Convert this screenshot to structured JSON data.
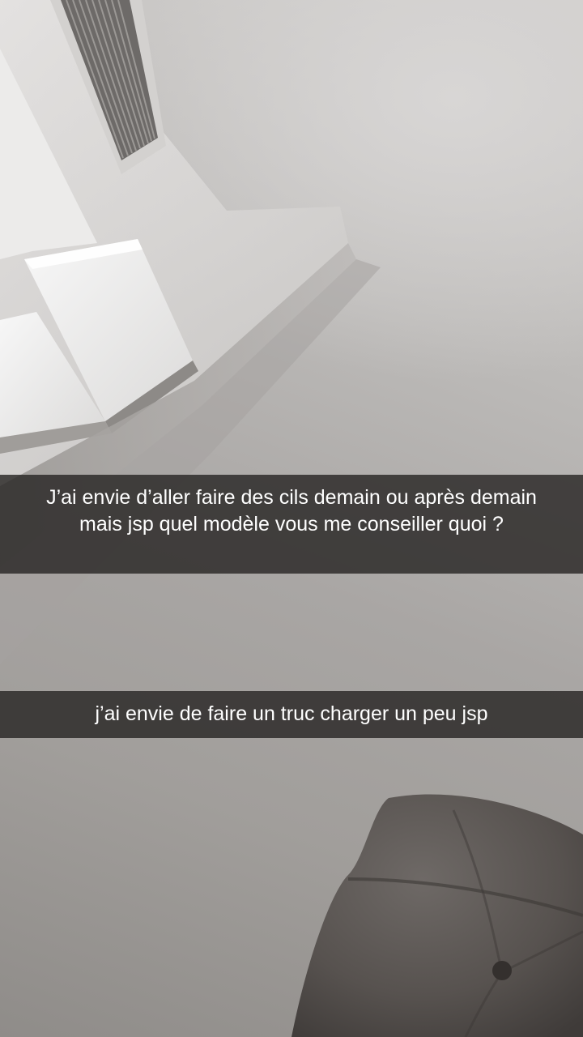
{
  "captions": [
    {
      "text": "J’ai envie d’aller faire des cils demain ou après demain mais jsp quel modèle vous me conseiller quoi ?"
    },
    {
      "text": "j’ai envie de faire un truc charger un peu jsp"
    }
  ],
  "colors": {
    "caption_background": "#282624",
    "caption_text": "#ffffff",
    "wall": "#bdbbb9",
    "chair": "#5a5552"
  },
  "icons": {
    "vent": "air-vent-grille",
    "chair": "upholstered-chair"
  }
}
